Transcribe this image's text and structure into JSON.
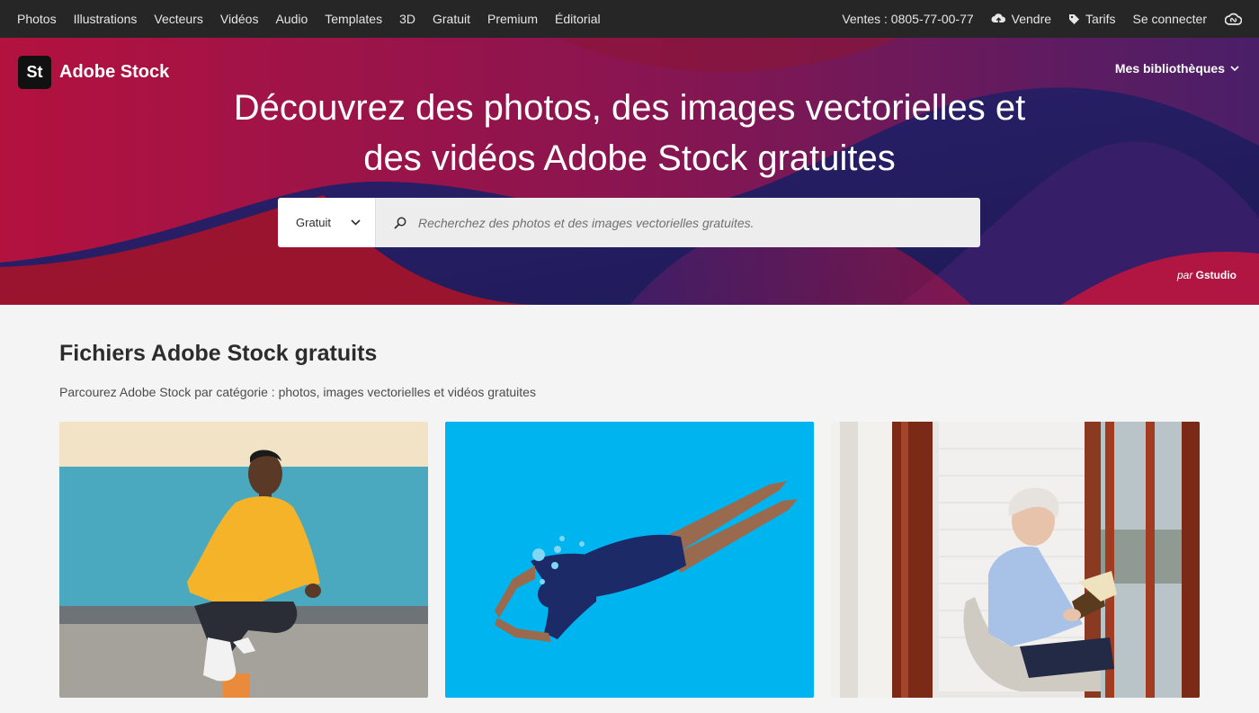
{
  "topnav": {
    "links": [
      "Photos",
      "Illustrations",
      "Vecteurs",
      "Vidéos",
      "Audio",
      "Templates",
      "3D",
      "Gratuit",
      "Premium",
      "Éditorial"
    ],
    "phone": "Ventes : 0805-77-00-77",
    "sell": "Vendre",
    "pricing": "Tarifs",
    "login": "Se connecter"
  },
  "hero": {
    "logo_text": "St",
    "brand": "Adobe Stock",
    "my_libraries": "Mes bibliothèques",
    "title_line1": "Découvrez des photos, des images vectorielles et",
    "title_line2": "des vidéos Adobe Stock gratuites",
    "search": {
      "filter_value": "Gratuit",
      "placeholder": "Recherchez des photos et des images vectorielles gratuites."
    },
    "credit_prefix": "par",
    "credit_name": "Gstudio"
  },
  "main": {
    "heading": "Fichiers Adobe Stock gratuits",
    "subheading": "Parcourez Adobe Stock par catégorie : photos, images vectorielles et vidéos gratuites"
  },
  "colors": {
    "topnav_bg": "#262626",
    "page_bg": "#f4f4f4",
    "vector_card_bg": "#00b4ef"
  }
}
